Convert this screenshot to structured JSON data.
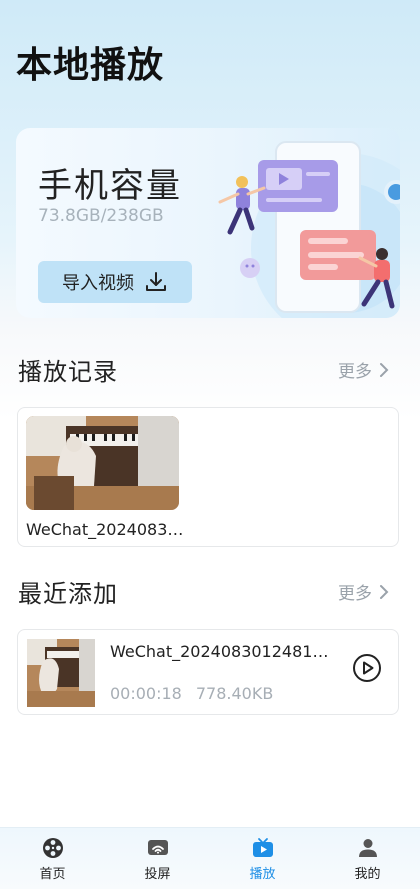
{
  "header": {
    "title": "本地播放"
  },
  "storage": {
    "title": "手机容量",
    "size_text": "73.8GB/238GB",
    "import_label": "导入视频",
    "import_icon": "download-icon"
  },
  "history": {
    "title": "播放记录",
    "more_label": "更多",
    "items": [
      {
        "name": "WeChat_2024083…"
      }
    ]
  },
  "recent": {
    "title": "最近添加",
    "more_label": "更多",
    "items": [
      {
        "name": "WeChat_2024083012481…",
        "duration": "00:00:18",
        "size": "778.40KB"
      }
    ]
  },
  "nav": {
    "items": [
      {
        "label": "首页",
        "icon": "film-reel-icon"
      },
      {
        "label": "投屏",
        "icon": "cast-icon"
      },
      {
        "label": "播放",
        "icon": "tv-play-icon",
        "active": true
      },
      {
        "label": "我的",
        "icon": "user-icon"
      }
    ]
  },
  "colors": {
    "active_nav": "#1e8fe6",
    "accent_light": "#bfe2f7"
  }
}
